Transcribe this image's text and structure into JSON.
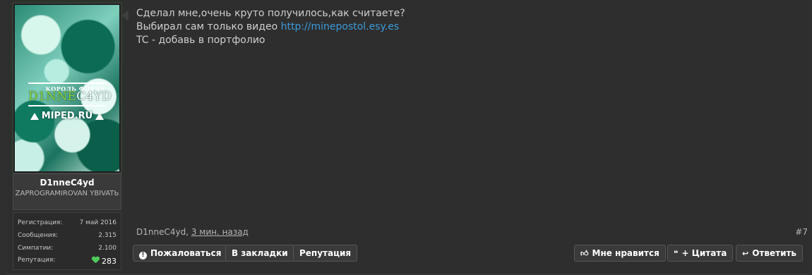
{
  "user": {
    "avatar": {
      "subtitle": "КОРОЛЬ ФЛУДА",
      "name_part1": "D1NNE",
      "name_part2": "C4YD",
      "brand": "MIPED.RU"
    },
    "username": "D1nneC4yd",
    "title": "ZAPROGRAMIROVAN YBIVATЬ",
    "stats": [
      {
        "label": "Регистрация:",
        "value": "7 май 2016"
      },
      {
        "label": "Сообщения:",
        "value": "2.315"
      },
      {
        "label": "Симпатии:",
        "value": "2.100"
      },
      {
        "label": "Репутация:",
        "value": "283"
      }
    ]
  },
  "message": {
    "line1": "Сделал мне,очень круто получилось,как считаете?",
    "line2_prefix": "Выбирал сам только видео ",
    "link": "http://minepostol.esy.es",
    "line3": "TC - добавь в портфолио"
  },
  "post_meta": {
    "author": "D1nneC4yd",
    "separator": ", ",
    "time": "3 мин. назад",
    "number": "#7"
  },
  "actions": {
    "report": "Пожаловаться",
    "bookmark": "В закладки",
    "reputation": "Репутация",
    "like": "Мне нравится",
    "quote": "+ Цитата",
    "reply": "Ответить"
  },
  "icons": {
    "report": "exclamation-circle-icon",
    "like": "thumbs-up-icon",
    "quote": "quote-icon",
    "reply": "reply-arrow-icon",
    "reputation_heart": "heart-icon"
  },
  "colors": {
    "background": "#2f2f2f",
    "link": "#3a9ad9",
    "heart": "#4ec95a",
    "accent_green": "#8cd13a"
  }
}
